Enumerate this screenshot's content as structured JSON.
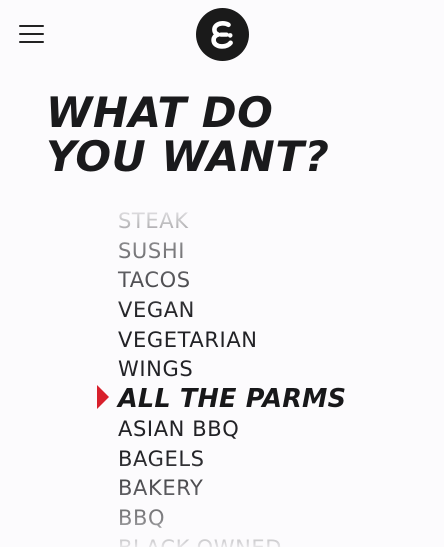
{
  "header": {
    "menu_icon": "hamburger-menu-icon",
    "logo_icon": "epsilon-logo-icon",
    "logo_bg_color": "#1a1a1a",
    "logo_fg_color": "#ffffff"
  },
  "headline": {
    "line1": "WHAT DO",
    "line2": "YOU WANT?"
  },
  "picker": {
    "selector_icon": "triangle-right-icon",
    "selector_color": "#d8202c",
    "selected_index": 6,
    "items": [
      {
        "label": "STEAK"
      },
      {
        "label": "SUSHI"
      },
      {
        "label": "TACOS"
      },
      {
        "label": "VEGAN"
      },
      {
        "label": "VEGETARIAN"
      },
      {
        "label": "WINGS"
      },
      {
        "label": "ALL THE PARMS"
      },
      {
        "label": "ASIAN BBQ"
      },
      {
        "label": "BAGELS"
      },
      {
        "label": "BAKERY"
      },
      {
        "label": "BBQ"
      },
      {
        "label": "BLACK-OWNED"
      }
    ]
  }
}
